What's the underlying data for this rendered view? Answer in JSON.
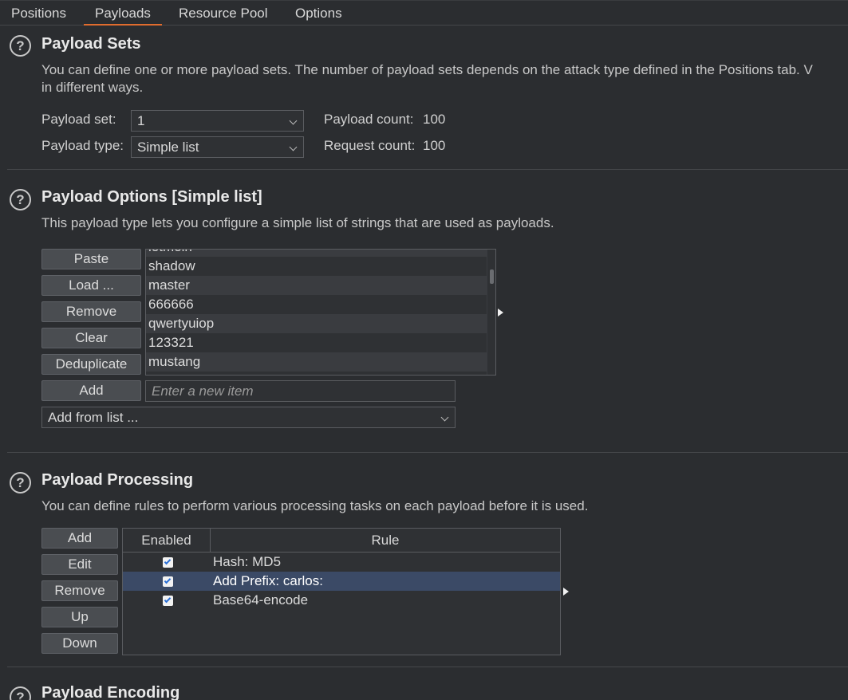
{
  "tabs": [
    {
      "label": "Positions",
      "active": false
    },
    {
      "label": "Payloads",
      "active": true
    },
    {
      "label": "Resource Pool",
      "active": false
    },
    {
      "label": "Options",
      "active": false
    }
  ],
  "help_glyph": "?",
  "payload_sets": {
    "title": "Payload Sets",
    "desc_line1": "You can define one or more payload sets. The number of payload sets depends on the attack type defined in the Positions tab. V",
    "desc_line2": "in different ways.",
    "set_label": "Payload set:",
    "set_value": "1",
    "type_label": "Payload type:",
    "type_value": "Simple list",
    "payload_count_label": "Payload count:",
    "payload_count": "100",
    "request_count_label": "Request count:",
    "request_count": "100"
  },
  "payload_options": {
    "title": "Payload Options [Simple list]",
    "desc": "This payload type lets you configure a simple list of strings that are used as payloads.",
    "buttons": {
      "paste": "Paste",
      "load": "Load ...",
      "remove": "Remove",
      "clear": "Clear",
      "deduplicate": "Deduplicate",
      "add": "Add"
    },
    "list_items": [
      "letmein",
      "shadow",
      "master",
      "666666",
      "qwertyuiop",
      "123321",
      "mustang"
    ],
    "add_placeholder": "Enter a new item",
    "add_from_list": "Add from list ..."
  },
  "payload_processing": {
    "title": "Payload Processing",
    "desc": "You can define rules to perform various processing tasks on each payload before it is used.",
    "buttons": {
      "add": "Add",
      "edit": "Edit",
      "remove": "Remove",
      "up": "Up",
      "down": "Down"
    },
    "columns": {
      "enabled": "Enabled",
      "rule": "Rule"
    },
    "rules": [
      {
        "enabled": true,
        "rule": "Hash: MD5",
        "selected": false
      },
      {
        "enabled": true,
        "rule": "Add Prefix: carlos:",
        "selected": true
      },
      {
        "enabled": true,
        "rule": "Base64-encode",
        "selected": false
      }
    ]
  },
  "payload_encoding": {
    "title": "Payload Encoding"
  },
  "colors": {
    "accent": "#e06c2e",
    "background": "#2b2d30",
    "selection": "#3b4a66",
    "checkbox_tick": "#2a6fd6"
  },
  "icons": {
    "help": "question-circle-icon",
    "dropdown": "chevron-down-icon",
    "expand": "triangle-right-icon"
  }
}
